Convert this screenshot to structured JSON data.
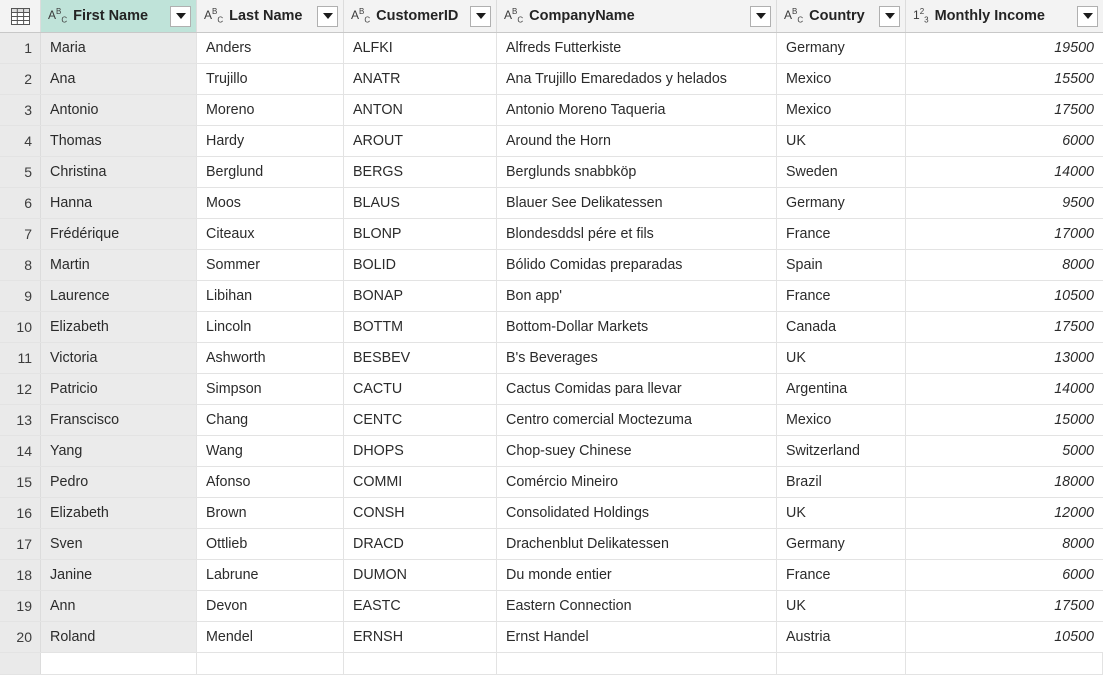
{
  "grid": {
    "corner_icon": "table-grid-icon",
    "accent_selected_header": "#bfe3d9",
    "row_number_bg": "#eaeaea",
    "selected_column": "First Name"
  },
  "columns": [
    {
      "name": "First Name",
      "type_icon": "ABC",
      "data_type": "text",
      "selected": true,
      "align": "left"
    },
    {
      "name": "Last Name",
      "type_icon": "ABC",
      "data_type": "text",
      "selected": false,
      "align": "left"
    },
    {
      "name": "CustomerID",
      "type_icon": "ABC",
      "data_type": "text",
      "selected": false,
      "align": "left"
    },
    {
      "name": "CompanyName",
      "type_icon": "ABC",
      "data_type": "text",
      "selected": false,
      "align": "left"
    },
    {
      "name": "Country",
      "type_icon": "ABC",
      "data_type": "text",
      "selected": false,
      "align": "left"
    },
    {
      "name": "Monthly Income",
      "type_icon": "123",
      "data_type": "number",
      "selected": false,
      "align": "right"
    }
  ],
  "rows": [
    {
      "n": "1",
      "first_name": "Maria",
      "last_name": "Anders",
      "customer_id": "ALFKI",
      "company_name": "Alfreds Futterkiste",
      "country": "Germany",
      "monthly_income": "19500"
    },
    {
      "n": "2",
      "first_name": "Ana",
      "last_name": "Trujillo",
      "customer_id": "ANATR",
      "company_name": "Ana Trujillo Emaredados y helados",
      "country": "Mexico",
      "monthly_income": "15500"
    },
    {
      "n": "3",
      "first_name": "Antonio",
      "last_name": "Moreno",
      "customer_id": "ANTON",
      "company_name": "Antonio Moreno Taqueria",
      "country": "Mexico",
      "monthly_income": "17500"
    },
    {
      "n": "4",
      "first_name": "Thomas",
      "last_name": "Hardy",
      "customer_id": "AROUT",
      "company_name": "Around the Horn",
      "country": "UK",
      "monthly_income": "6000"
    },
    {
      "n": "5",
      "first_name": "Christina",
      "last_name": "Berglund",
      "customer_id": "BERGS",
      "company_name": "Berglunds snabbköp",
      "country": "Sweden",
      "monthly_income": "14000"
    },
    {
      "n": "6",
      "first_name": "Hanna",
      "last_name": "Moos",
      "customer_id": "BLAUS",
      "company_name": "Blauer See Delikatessen",
      "country": "Germany",
      "monthly_income": "9500"
    },
    {
      "n": "7",
      "first_name": "Frédérique",
      "last_name": "Citeaux",
      "customer_id": "BLONP",
      "company_name": "Blondesddsl pére et fils",
      "country": "France",
      "monthly_income": "17000"
    },
    {
      "n": "8",
      "first_name": "Martin",
      "last_name": "Sommer",
      "customer_id": "BOLID",
      "company_name": "Bólido Comidas preparadas",
      "country": "Spain",
      "monthly_income": "8000"
    },
    {
      "n": "9",
      "first_name": "Laurence",
      "last_name": "Libihan",
      "customer_id": "BONAP",
      "company_name": "Bon app'",
      "country": "France",
      "monthly_income": "10500"
    },
    {
      "n": "10",
      "first_name": "Elizabeth",
      "last_name": "Lincoln",
      "customer_id": "BOTTM",
      "company_name": "Bottom-Dollar Markets",
      "country": "Canada",
      "monthly_income": "17500"
    },
    {
      "n": "11",
      "first_name": "Victoria",
      "last_name": "Ashworth",
      "customer_id": "BESBEV",
      "company_name": "B's Beverages",
      "country": "UK",
      "monthly_income": "13000"
    },
    {
      "n": "12",
      "first_name": "Patricio",
      "last_name": "Simpson",
      "customer_id": "CACTU",
      "company_name": "Cactus Comidas para llevar",
      "country": "Argentina",
      "monthly_income": "14000"
    },
    {
      "n": "13",
      "first_name": "Franscisco",
      "last_name": "Chang",
      "customer_id": "CENTC",
      "company_name": "Centro comercial Moctezuma",
      "country": "Mexico",
      "monthly_income": "15000"
    },
    {
      "n": "14",
      "first_name": "Yang",
      "last_name": "Wang",
      "customer_id": "DHOPS",
      "company_name": "Chop-suey Chinese",
      "country": "Switzerland",
      "monthly_income": "5000"
    },
    {
      "n": "15",
      "first_name": "Pedro",
      "last_name": "Afonso",
      "customer_id": "COMMI",
      "company_name": "Comércio Mineiro",
      "country": "Brazil",
      "monthly_income": "18000"
    },
    {
      "n": "16",
      "first_name": "Elizabeth",
      "last_name": "Brown",
      "customer_id": "CONSH",
      "company_name": "Consolidated Holdings",
      "country": "UK",
      "monthly_income": "12000"
    },
    {
      "n": "17",
      "first_name": "Sven",
      "last_name": "Ottlieb",
      "customer_id": "DRACD",
      "company_name": "Drachenblut Delikatessen",
      "country": "Germany",
      "monthly_income": "8000"
    },
    {
      "n": "18",
      "first_name": "Janine",
      "last_name": "Labrune",
      "customer_id": "DUMON",
      "company_name": "Du monde entier",
      "country": "France",
      "monthly_income": "6000"
    },
    {
      "n": "19",
      "first_name": "Ann",
      "last_name": "Devon",
      "customer_id": "EASTC",
      "company_name": "Eastern Connection",
      "country": "UK",
      "monthly_income": "17500"
    },
    {
      "n": "20",
      "first_name": "Roland",
      "last_name": "Mendel",
      "customer_id": "ERNSH",
      "company_name": "Ernst Handel",
      "country": "Austria",
      "monthly_income": "10500"
    }
  ]
}
